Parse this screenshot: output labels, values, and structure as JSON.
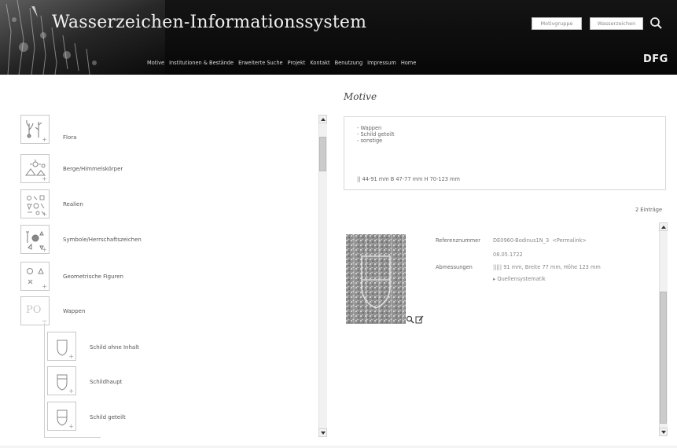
{
  "header": {
    "title": "Wasserzeichen-Informationssystem",
    "buttons": {
      "motivgruppe": "Motivgruppe",
      "wasserzeichen": "Wasserzeichen"
    },
    "search_icon": "search-icon",
    "logo": "DFG",
    "nav": [
      "Motive",
      "Institutionen & Bestände",
      "Erweiterte Suche",
      "Projekt",
      "Kontakt",
      "Benutzung",
      "Impressum",
      "Home"
    ]
  },
  "categories": [
    {
      "label": "Flora",
      "icon": "flora-thumbnail"
    },
    {
      "label": "Berge/Himmelskörper",
      "icon": "berge-thumbnail"
    },
    {
      "label": "Realien",
      "icon": "realien-thumbnail"
    },
    {
      "label": "Symbole/Herrschaftszeichen",
      "icon": "symbole-thumbnail"
    },
    {
      "label": "Geometrische Figuren",
      "icon": "geometrische-thumbnail"
    },
    {
      "label": "Wappen",
      "icon": "wappen-thumbnail",
      "thumb_text": "PO"
    }
  ],
  "subcategories": [
    {
      "label": "Schild ohne Inhalt",
      "icon": "schild-ohne-inhalt-thumbnail"
    },
    {
      "label": "Schildhaupt",
      "icon": "schildhaupt-thumbnail"
    },
    {
      "label": "Schild geteilt",
      "icon": "schild-geteilt-thumbnail"
    }
  ],
  "main": {
    "heading": "Motive",
    "info": {
      "lines": [
        "- Wappen",
        "- Schild geteilt",
        "- sonstige"
      ],
      "dimensions": "|| 44-91 mm  B 47-77 mm  H 70-123 mm"
    },
    "entries_count": "2 Einträge",
    "result": {
      "ref_label": "Referenznummer",
      "ref_value": "DE0960-Bodinus1N_3",
      "permalink": "<Permalink>",
      "date": "08.05.1722",
      "abm_label": "Abmessungen",
      "abm_value": "||||| 91 mm, Breite 77 mm, Höhe 123 mm",
      "quellen_link": "▸ Quellensystematik"
    }
  },
  "colors": {
    "header_bg": "#0b0b0b",
    "header_text": "#f0f0f0",
    "border": "#d8d8d8"
  }
}
